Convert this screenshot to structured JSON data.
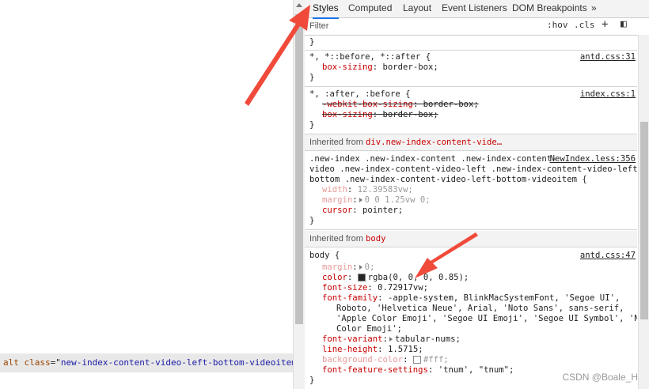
{
  "elements_panel": {
    "code_line": {
      "tag": "alt",
      "attr": "class",
      "value": "new-index-content-video-left-bottom-videoitem-cove"
    }
  },
  "tabs": [
    {
      "label": "Styles",
      "active": true
    },
    {
      "label": "Computed",
      "active": false
    },
    {
      "label": "Layout",
      "active": false
    },
    {
      "label": "Event Listeners",
      "active": false
    },
    {
      "label": "DOM Breakpoints",
      "active": false
    },
    {
      "label": "»",
      "active": false
    }
  ],
  "filter": {
    "placeholder": "Filter",
    "hov": ":hov",
    "cls": ".cls",
    "add": "+",
    "toggle": "◧"
  },
  "rules": [
    {
      "selector_top": "}",
      "selector": "*, *::before, *::after {",
      "source": "antd.css:31",
      "props": [
        {
          "name": "box-sizing",
          "value": "border-box;",
          "strike": false,
          "dim": false
        }
      ],
      "close": "}"
    },
    {
      "selector": "*, :after, :before {",
      "source": "index.css:1",
      "props": [
        {
          "name": "-webkit-box-sizing",
          "value": "border-box;",
          "strike": true
        },
        {
          "name": "box-sizing",
          "value": "border-box;",
          "strike": true
        }
      ],
      "close": "}"
    }
  ],
  "inherited1": {
    "label": "Inherited from",
    "selector": "div.new-index-content-vide…"
  },
  "rule3": {
    "selector_lines": [
      ".new-index .new-index-content .new-index-content-",
      "video .new-index-content-video-left .new-index-content-video-left-",
      "bottom .new-index-content-video-left-bottom-videoitem {"
    ],
    "source": "NewIndex.less:356",
    "props": [
      {
        "name": "width",
        "value": "12.39583vw;",
        "dim": true
      },
      {
        "name": "margin",
        "value": "0 0 1.25vw 0;",
        "dim": true
      },
      {
        "name": "cursor",
        "value": "pointer;",
        "dim": false
      }
    ],
    "close": "}"
  },
  "inherited2": {
    "label": "Inherited from",
    "selector": "body"
  },
  "rule4": {
    "selector": "body {",
    "source": "antd.css:47",
    "props": {
      "margin": {
        "name": "margin",
        "value": "0;"
      },
      "color": {
        "name": "color",
        "value": "rgba(0, 0, 0, 0.85);",
        "swatch": "#262626"
      },
      "font_size": {
        "name": "font-size",
        "value": "0.72917vw;"
      },
      "font_family": {
        "name": "font-family",
        "lines": [
          "-apple-system, BlinkMacSystemFont, 'Segoe UI',",
          "Roboto, 'Helvetica Neue', Arial, 'Noto Sans', sans-serif,",
          "'Apple Color Emoji', 'Segoe UI Emoji', 'Segoe UI Symbol', 'Noto",
          "Color Emoji';"
        ]
      },
      "font_variant": {
        "name": "font-variant",
        "value": "tabular-nums;"
      },
      "line_height": {
        "name": "line-height",
        "value": "1.5715;"
      },
      "background_color": {
        "name": "background-color",
        "value": "#fff;",
        "swatch": "#ffffff"
      },
      "font_feature": {
        "name": "font-feature-settings",
        "value": "'tnum', \"tnum\";"
      }
    },
    "close": "}"
  },
  "watermark": "CSDN @Boale_H",
  "colors": {
    "arrow": "#f04a3a",
    "active_tab": "#1a73e8",
    "property": "#c80000"
  }
}
